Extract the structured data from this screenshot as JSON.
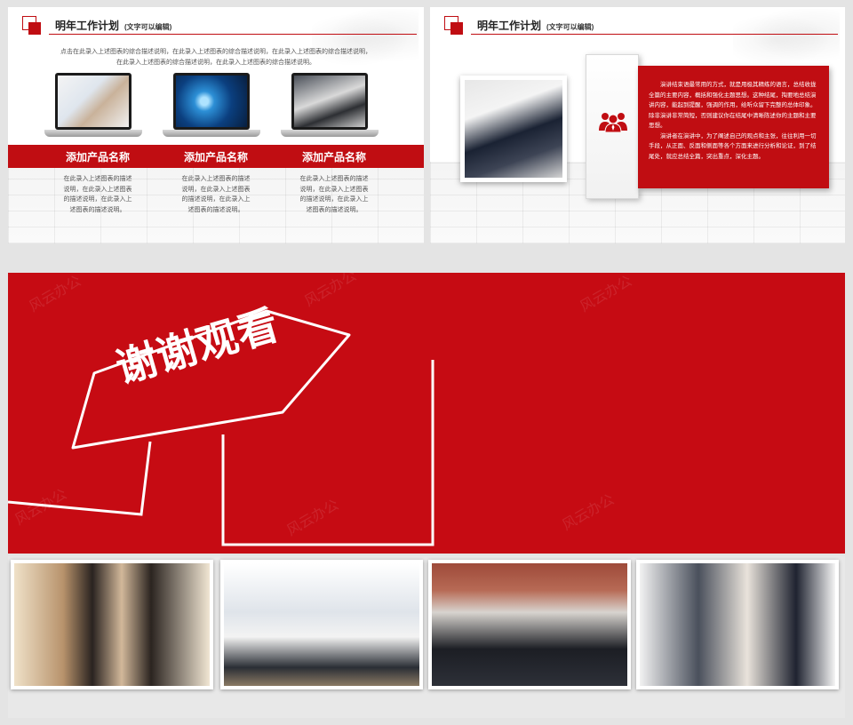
{
  "slide_left": {
    "title": "明年工作计划",
    "title_note": "(文字可以编辑)",
    "intro_lines": [
      "点击在此录入上述图表的综合描述说明，在此录入上述图表的综合描述说明，在此录入上述图表的综合描述说明，",
      "在此录入上述图表的综合描述说明，在此录入上述图表的综合描述说明。"
    ],
    "products": [
      {
        "title": "添加产品名称",
        "desc": [
          "在此录入上述图表的描述",
          "说明，在此录入上述图表",
          "的描述说明，在此录入上",
          "述图表的描述说明。"
        ]
      },
      {
        "title": "添加产品名称",
        "desc": [
          "在此录入上述图表的描述",
          "说明，在此录入上述图表",
          "的描述说明，在此录入上",
          "述图表的描述说明。"
        ]
      },
      {
        "title": "添加产品名称",
        "desc": [
          "在此录入上述图表的描述",
          "说明，在此录入上述图表",
          "的描述说明，在此录入上",
          "述图表的描述说明。"
        ]
      }
    ]
  },
  "slide_right": {
    "title": "明年工作计划",
    "title_note": "(文字可以编辑)",
    "icon": "team-icon",
    "paragraphs": [
      "演讲结束语最常用的方式，就是用极其精练的语言，总结收拢全篇的主要内容，概括和强化主题思想。这种结尾，掏要地总结演讲内容，能起到提醒，强调的作用，给听众留下完整的总体印象。除非演讲非常简短，否则建议你在结尾中清晰陈述你的主题和主要思想。",
      "演讲者在演讲中，为了阐述自己的观点和主张，往往利用一切手段，从正面、反面和侧面等各个方面来进行分析和论证，到了结尾处，就应总结全篇，突出重点，深化主题。"
    ]
  },
  "thanks": {
    "text": "谢谢观看",
    "watermark": "风云办公"
  },
  "colors": {
    "brand_red": "#c00d12",
    "background": "#e4e4e4"
  }
}
